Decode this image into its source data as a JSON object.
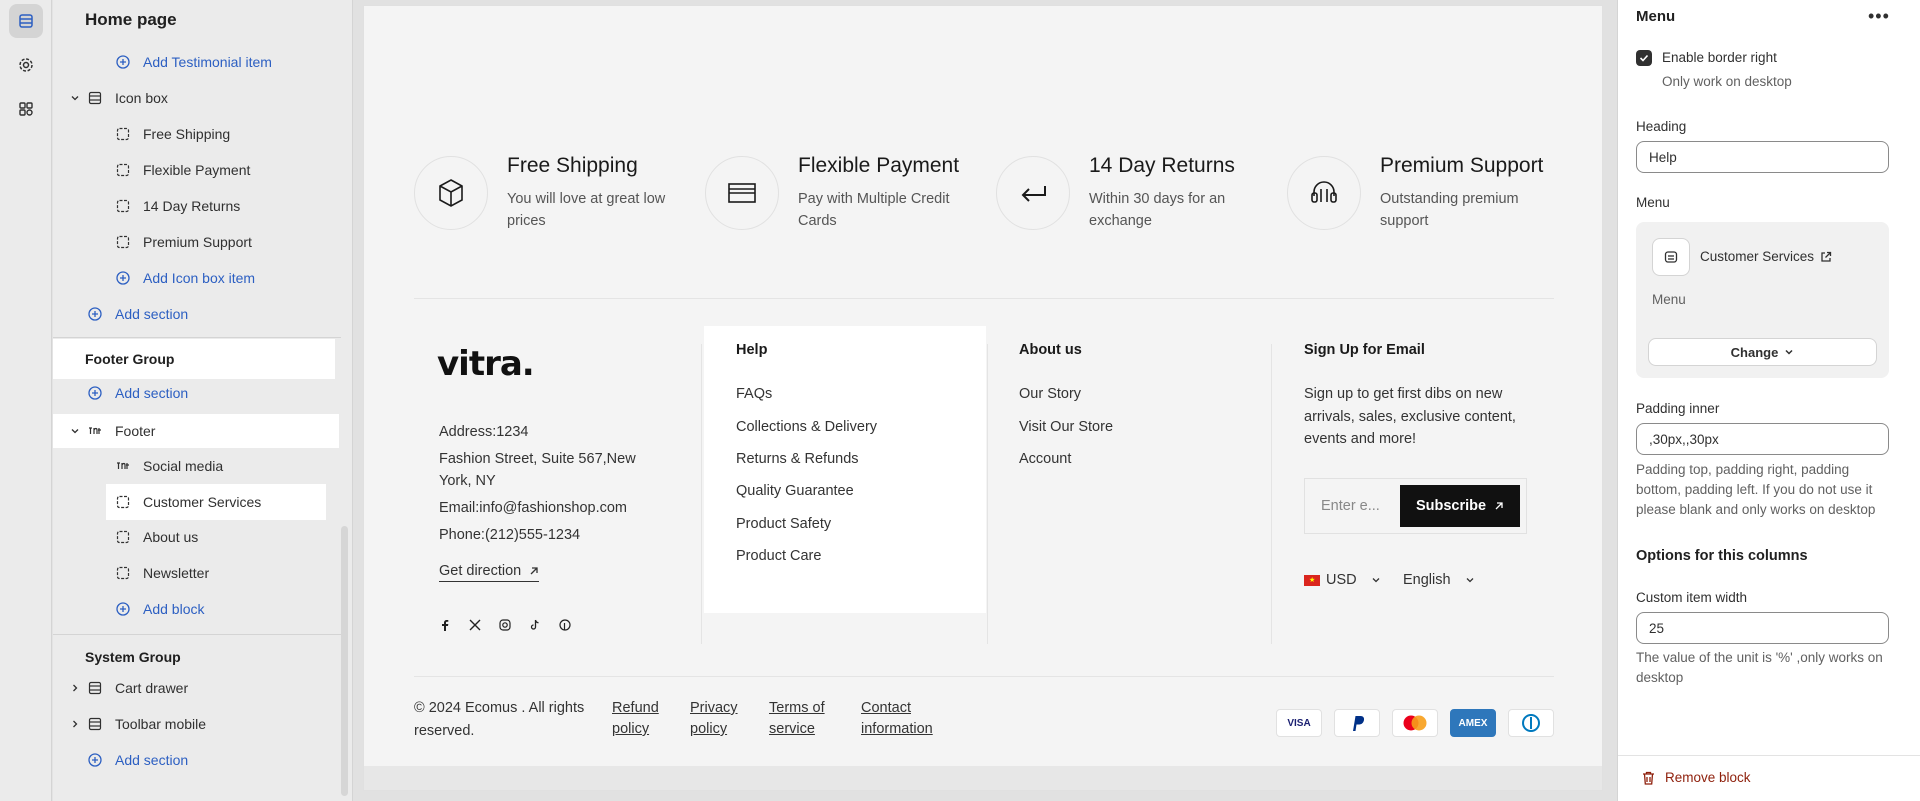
{
  "tree": {
    "title": "Home page",
    "add_testimonial": "Add Testimonial item",
    "icon_box": "Icon box",
    "icon_items": [
      "Free Shipping",
      "Flexible Payment",
      "14 Day Returns",
      "Premium Support"
    ],
    "add_icon_box_item": "Add Icon box item",
    "add_section_1": "Add section",
    "footer_group": "Footer Group",
    "add_section_2": "Add section",
    "footer": "Footer",
    "footer_blocks": [
      "Social media",
      "Customer Services",
      "About us",
      "Newsletter"
    ],
    "add_block": "Add block",
    "system_group": "System Group",
    "cart_drawer": "Cart drawer",
    "toolbar_mobile": "Toolbar mobile",
    "add_section_3": "Add section"
  },
  "preview": {
    "icon_boxes": [
      {
        "title": "Free Shipping",
        "desc": "You will love at great low prices",
        "icon": "box-icon"
      },
      {
        "title": "Flexible Payment",
        "desc": "Pay with Multiple Credit Cards",
        "icon": "card-icon"
      },
      {
        "title": "14 Day Returns",
        "desc": "Within 30 days for an exchange",
        "icon": "return-arrow-icon"
      },
      {
        "title": "Premium Support",
        "desc": "Outstanding premium support",
        "icon": "headset-icon"
      }
    ],
    "logo": "vitra.",
    "address_1": "Address:1234",
    "address_2": "Fashion Street, Suite 567,New",
    "address_3": "York, NY",
    "email": "Email:info@fashionshop.com",
    "phone": "Phone:(212)555-1234",
    "get_direction": "Get direction",
    "help_heading": "Help",
    "help_links": [
      "FAQs",
      "Collections & Delivery",
      "Returns & Refunds",
      "Quality Guarantee",
      "Product Safety",
      "Product Care"
    ],
    "about_heading": "About us",
    "about_links": [
      "Our Story",
      "Visit Our Store",
      "Account"
    ],
    "signup_heading": "Sign Up for Email",
    "signup_text_1": "Sign up to get first dibs on new",
    "signup_text_2": "arrivals, sales, exclusive content,",
    "signup_text_3": "events and more!",
    "email_placeholder": "Enter e...",
    "subscribe": "Subscribe",
    "currency": "USD",
    "language": "English",
    "copyright_1": "© 2024 Ecomus . All rights",
    "copyright_2": "reserved.",
    "legal": [
      {
        "l1": "Refund",
        "l2": "policy"
      },
      {
        "l1": "Privacy",
        "l2": "policy"
      },
      {
        "l1": "Terms of",
        "l2": "service"
      },
      {
        "l1": "Contact",
        "l2": "information"
      }
    ],
    "payments": [
      "VISA",
      "PayPal",
      "Mastercard",
      "AMEX",
      "Diners"
    ]
  },
  "panel": {
    "title": "Menu",
    "enable_border_right": "Enable border right",
    "only_desktop": "Only work on desktop",
    "heading_label": "Heading",
    "heading_value": "Help",
    "menu_label": "Menu",
    "menu_name": "Customer Services",
    "menu_sub": "Menu",
    "change": "Change",
    "padding_label": "Padding inner",
    "padding_value": ",30px,,30px",
    "padding_hint": "Padding top, padding right, padding bottom, padding left. If you do not use it please blank and only works on desktop",
    "options_heading": "Options for this columns",
    "width_label": "Custom item width",
    "width_value": "25",
    "width_hint": "The value of the unit is '%' ,only works on desktop",
    "remove_block": "Remove block"
  },
  "colors": {
    "accent_blue": "#2c5fc2",
    "remove_red": "#8e1f0b",
    "highlight": "#ffffff"
  }
}
